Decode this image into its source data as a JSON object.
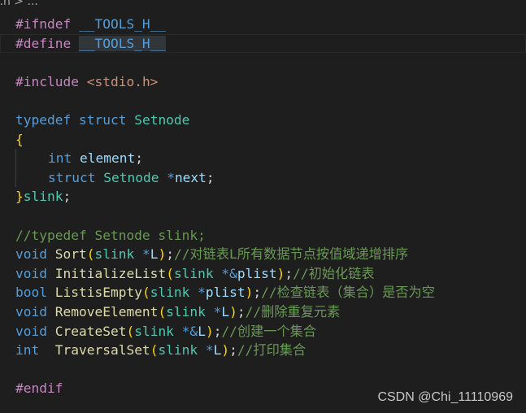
{
  "breadcrumb": {
    "file": "t.h",
    "separator": ">",
    "more": "..."
  },
  "colors": {
    "background": "#1e1e1e",
    "preprocessor": "#c586c0",
    "keyword": "#569cd6",
    "type": "#4ec9b0",
    "function": "#dcdcaa",
    "variable": "#9cdcfe",
    "comment": "#6a9955",
    "string": "#ce9178",
    "bracket": "#ffd700"
  },
  "current_line": 2,
  "lines": [
    [
      [
        "#ifndef ",
        "pre"
      ],
      [
        "__TOOLS_H__",
        "macro"
      ]
    ],
    [
      [
        "#define ",
        "pre"
      ],
      [
        "__TOOLS_H__",
        "macro sel"
      ]
    ],
    [],
    [
      [
        "#include ",
        "pre"
      ],
      [
        "<stdio.h>",
        "str"
      ]
    ],
    [],
    [
      [
        "typedef ",
        "kw"
      ],
      [
        "struct ",
        "kw"
      ],
      [
        "Setnode",
        "type"
      ]
    ],
    [
      [
        "{",
        "brace"
      ]
    ],
    [
      [
        "    ",
        "indent"
      ],
      [
        "int ",
        "kw"
      ],
      [
        "element",
        "var"
      ],
      [
        ";",
        "plain"
      ]
    ],
    [
      [
        "    ",
        "indent"
      ],
      [
        "struct ",
        "kw"
      ],
      [
        "Setnode ",
        "type"
      ],
      [
        "*",
        "op"
      ],
      [
        "next",
        "var"
      ],
      [
        ";",
        "plain"
      ]
    ],
    [
      [
        "}",
        "brace"
      ],
      [
        "slink",
        "type"
      ],
      [
        ";",
        "plain"
      ]
    ],
    [],
    [
      [
        "//typedef Setnode slink;",
        "com"
      ]
    ],
    [
      [
        "void ",
        "kw"
      ],
      [
        "Sort",
        "fn"
      ],
      [
        "(",
        "brace"
      ],
      [
        "slink ",
        "type"
      ],
      [
        "*",
        "op"
      ],
      [
        "L",
        "var"
      ],
      [
        ")",
        "brace"
      ],
      [
        ";",
        "plain"
      ],
      [
        "//对链表L所有数据节点按值域递增排序",
        "com"
      ]
    ],
    [
      [
        "void ",
        "kw"
      ],
      [
        "InitializeList",
        "fn"
      ],
      [
        "(",
        "brace"
      ],
      [
        "slink ",
        "type"
      ],
      [
        "*&",
        "op"
      ],
      [
        "plist",
        "var"
      ],
      [
        ")",
        "brace"
      ],
      [
        ";",
        "plain"
      ],
      [
        "//初始化链表",
        "com"
      ]
    ],
    [
      [
        "bool ",
        "kw"
      ],
      [
        "ListisEmpty",
        "fn"
      ],
      [
        "(",
        "brace"
      ],
      [
        "slink ",
        "type"
      ],
      [
        "*",
        "op"
      ],
      [
        "plist",
        "var"
      ],
      [
        ")",
        "brace"
      ],
      [
        ";",
        "plain"
      ],
      [
        "//检查链表（集合）是否为空",
        "com"
      ]
    ],
    [
      [
        "void ",
        "kw"
      ],
      [
        "RemoveElement",
        "fn"
      ],
      [
        "(",
        "brace"
      ],
      [
        "slink ",
        "type"
      ],
      [
        "*",
        "op"
      ],
      [
        "L",
        "var"
      ],
      [
        ")",
        "brace"
      ],
      [
        ";",
        "plain"
      ],
      [
        "//删除重复元素",
        "com"
      ]
    ],
    [
      [
        "void ",
        "kw"
      ],
      [
        "CreateSet",
        "fn"
      ],
      [
        "(",
        "brace"
      ],
      [
        "slink ",
        "type"
      ],
      [
        "*&",
        "op"
      ],
      [
        "L",
        "var"
      ],
      [
        ")",
        "brace"
      ],
      [
        ";",
        "plain"
      ],
      [
        "//创建一个集合",
        "com"
      ]
    ],
    [
      [
        "int  ",
        "kw"
      ],
      [
        "TraversalSet",
        "fn"
      ],
      [
        "(",
        "brace"
      ],
      [
        "slink ",
        "type"
      ],
      [
        "*",
        "op"
      ],
      [
        "L",
        "var"
      ],
      [
        ")",
        "brace"
      ],
      [
        ";",
        "plain"
      ],
      [
        "//打印集合",
        "com"
      ]
    ],
    [],
    [
      [
        "#endif",
        "pre"
      ]
    ]
  ],
  "watermark": "CSDN @Chi_11110969"
}
